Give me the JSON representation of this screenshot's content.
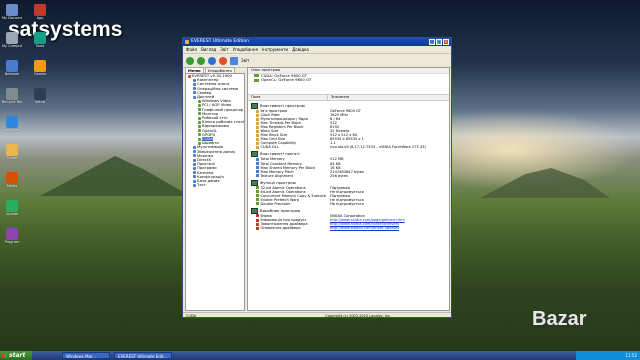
{
  "desktop": {
    "brand": "satsystems",
    "watermark": "Bazar",
    "icons": [
      "My Documents",
      "My Computer",
      "Network",
      "Recycle Bin",
      "Internet",
      "Folder",
      "Media",
      "Update",
      "Program",
      "App",
      "Tools",
      "Games",
      "Setup"
    ]
  },
  "taskbar": {
    "start_label": "start",
    "buttons": [
      "Windows Mar...",
      "EVEREST Ultimate Edit..."
    ],
    "clock": "11:52"
  },
  "window": {
    "title": "EVEREST Ultimate Edition",
    "menu": [
      "Файл",
      "Вигляд",
      "Звіт",
      "Уподобання",
      "Інструменти",
      "Довідка"
    ],
    "toolbar_label": "Звіт",
    "tabs": [
      "Меню",
      "Уподобання"
    ],
    "tree": [
      {
        "label": "EVEREST v5.30.1900",
        "sel": false,
        "color": "#d14b2a",
        "indent": 0
      },
      {
        "label": "Комп'ютер",
        "sel": false,
        "color": "#4a7bd0",
        "indent": 1
      },
      {
        "label": "Системна плата",
        "sel": false,
        "color": "#4a7bd0",
        "indent": 1
      },
      {
        "label": "Операційна система",
        "sel": false,
        "color": "#4a7bd0",
        "indent": 1
      },
      {
        "label": "Сервер",
        "sel": false,
        "color": "#4a7bd0",
        "indent": 1
      },
      {
        "label": "Дисплей",
        "sel": false,
        "color": "#4a7bd0",
        "indent": 1
      },
      {
        "label": "Windows Video",
        "sel": false,
        "color": "#5a9c3a",
        "indent": 2
      },
      {
        "label": "PCI / AGP Video",
        "sel": false,
        "color": "#5a9c3a",
        "indent": 2
      },
      {
        "label": "Графічний процесор",
        "sel": false,
        "color": "#5a9c3a",
        "indent": 2
      },
      {
        "label": "Монітор",
        "sel": false,
        "color": "#5a9c3a",
        "indent": 2
      },
      {
        "label": "Робочий стіл",
        "sel": false,
        "color": "#5a9c3a",
        "indent": 2
      },
      {
        "label": "Кілька робочих столів",
        "sel": false,
        "color": "#5a9c3a",
        "indent": 2
      },
      {
        "label": "Відеорежими",
        "sel": false,
        "color": "#5a9c3a",
        "indent": 2
      },
      {
        "label": "OpenGL",
        "sel": false,
        "color": "#5a9c3a",
        "indent": 2
      },
      {
        "label": "GPGPU",
        "sel": false,
        "color": "#5a9c3a",
        "indent": 2
      },
      {
        "label": "CUDA",
        "sel": true,
        "color": "#5a9c3a",
        "indent": 2
      },
      {
        "label": "Шрифти",
        "sel": false,
        "color": "#5a9c3a",
        "indent": 2
      },
      {
        "label": "Мультимедіа",
        "sel": false,
        "color": "#4a7bd0",
        "indent": 1
      },
      {
        "label": "Збереження даних",
        "sel": false,
        "color": "#4a7bd0",
        "indent": 1
      },
      {
        "label": "Мережа",
        "sel": false,
        "color": "#4a7bd0",
        "indent": 1
      },
      {
        "label": "DirectX",
        "sel": false,
        "color": "#4a7bd0",
        "indent": 1
      },
      {
        "label": "Пристрої",
        "sel": false,
        "color": "#4a7bd0",
        "indent": 1
      },
      {
        "label": "Програми",
        "sel": false,
        "color": "#4a7bd0",
        "indent": 1
      },
      {
        "label": "Безпека",
        "sel": false,
        "color": "#4a7bd0",
        "indent": 1
      },
      {
        "label": "Конфігурація",
        "sel": false,
        "color": "#4a7bd0",
        "indent": 1
      },
      {
        "label": "База даних",
        "sel": false,
        "color": "#4a7bd0",
        "indent": 1
      },
      {
        "label": "Тест",
        "sel": false,
        "color": "#4a7bd0",
        "indent": 1
      }
    ],
    "device_header": "Опис пристрою",
    "devices": [
      "CUDA: GeForce 9600 GT",
      "OpenCL: GeForce 9600 GT"
    ],
    "columns": [
      "Поле",
      "Значення"
    ],
    "groups": [
      {
        "title": "Властивості пристрою",
        "rows": [
          {
            "f": "Ім'я пристрою",
            "v": "GeForce 9600 GT",
            "link": false
          },
          {
            "f": "Clock Rate",
            "v": "1625 MHz",
            "link": false
          },
          {
            "f": "Мультипроцесори / Ядра",
            "v": "8 / 64",
            "link": false
          },
          {
            "f": "Max Threads Per Block",
            "v": "512",
            "link": false
          },
          {
            "f": "Max Registers Per Block",
            "v": "8192",
            "link": false
          },
          {
            "f": "Warp Size",
            "v": "32 threads",
            "link": false
          },
          {
            "f": "Max Block Size",
            "v": "512 x 512 x 64",
            "link": false
          },
          {
            "f": "Max Grid Size",
            "v": "65535 x 65535 x 1",
            "link": false
          },
          {
            "f": "Compute Capability",
            "v": "1.1",
            "link": false
          },
          {
            "f": "CUDA DLL",
            "v": "nvcuda.dll (8.17.12.7533 - nVIDIA ForceWare 275.33)",
            "link": false
          }
        ]
      },
      {
        "title": "Властивості пам'яті",
        "rows": [
          {
            "f": "Total Memory",
            "v": "512 MB",
            "link": false
          },
          {
            "f": "Total Constant Memory",
            "v": "64 KB",
            "link": false
          },
          {
            "f": "Max Shared Memory Per Block",
            "v": "16 KB",
            "link": false
          },
          {
            "f": "Max Memory Pitch",
            "v": "2147483647 bytes",
            "link": false
          },
          {
            "f": "Texture Alignment",
            "v": "256 bytes",
            "link": false
          }
        ]
      },
      {
        "title": "Функції пристрою",
        "rows": [
          {
            "f": "32-bit Atomic Operations",
            "v": "Підтримка",
            "link": false
          },
          {
            "f": "64-bit Atomic Operations",
            "v": "Не підтримується",
            "link": false
          },
          {
            "f": "Concurrent Memory Copy & Execute",
            "v": "Підтримка",
            "link": false
          },
          {
            "f": "Enable Prefetch Warp",
            "v": "Не підтримується",
            "link": false
          },
          {
            "f": "Double Precision",
            "v": "Не підтримується",
            "link": false
          }
        ]
      },
      {
        "title": "Виробник пристрою",
        "rows": [
          {
            "f": "Фірма",
            "v": "NVIDIA Corporation",
            "link": false
          },
          {
            "f": "Інформація про продукт",
            "v": "http://www.nvidia.com/page/geforce.html",
            "link": true
          },
          {
            "f": "Завантаження драйвера",
            "v": "http://www.nvidia.com/content/drivers",
            "link": true
          },
          {
            "f": "Оновлення драйвера",
            "v": "http://www.aida64.com/driver-updates",
            "link": true
          }
        ]
      }
    ],
    "status_left": "CUDA",
    "status_right": "Copyright (c) 2003-2010 Lavalys, Inc."
  },
  "colors": {
    "accent": "#0d3891",
    "tree_select": "#316ac5",
    "link": "#1a36c4"
  }
}
